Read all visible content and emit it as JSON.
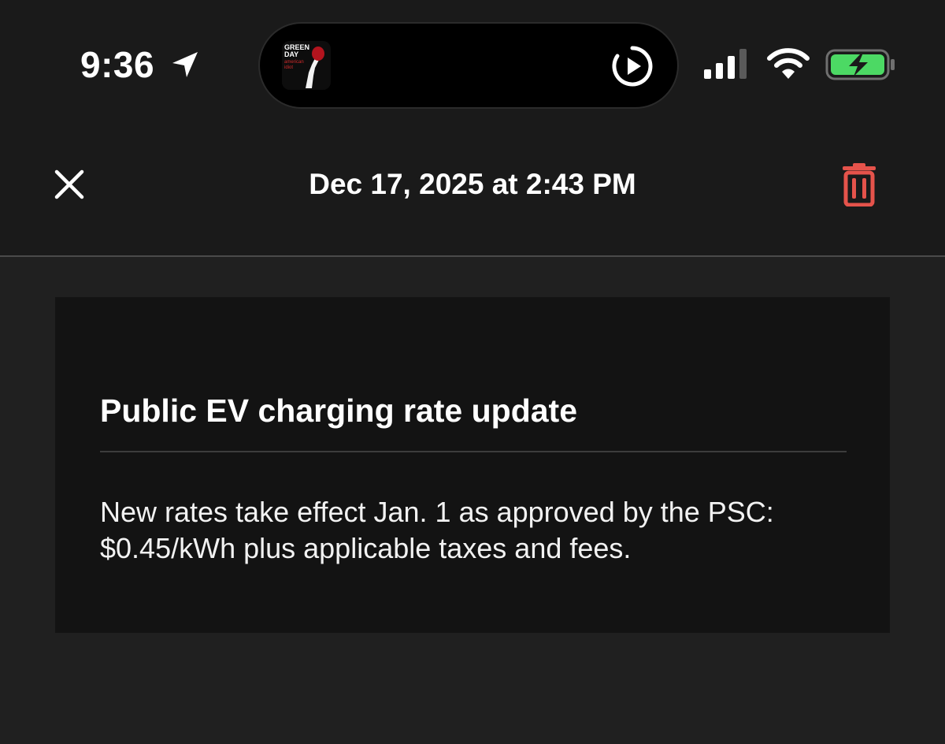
{
  "status_bar": {
    "time": "9:36",
    "location_icon": "location-arrow-icon",
    "now_playing": {
      "album_text_line1": "GREEN",
      "album_text_line2": "DAY",
      "album_text_line3": "american",
      "album_text_line4": "idiot",
      "play_icon": "play-circle-icon"
    },
    "signal_icon": "cellular-signal-icon",
    "wifi_icon": "wifi-icon",
    "battery_icon": "battery-charging-icon",
    "battery_color": "#4cd964"
  },
  "nav": {
    "close_icon": "close-icon",
    "title": "Dec 17, 2025 at 2:43 PM",
    "delete_icon": "trash-icon",
    "delete_color": "#e5534b"
  },
  "message": {
    "title": "Public EV charging rate update",
    "body": "New rates take effect Jan. 1 as approved by the PSC: $0.45/kWh plus applicable taxes and fees."
  }
}
